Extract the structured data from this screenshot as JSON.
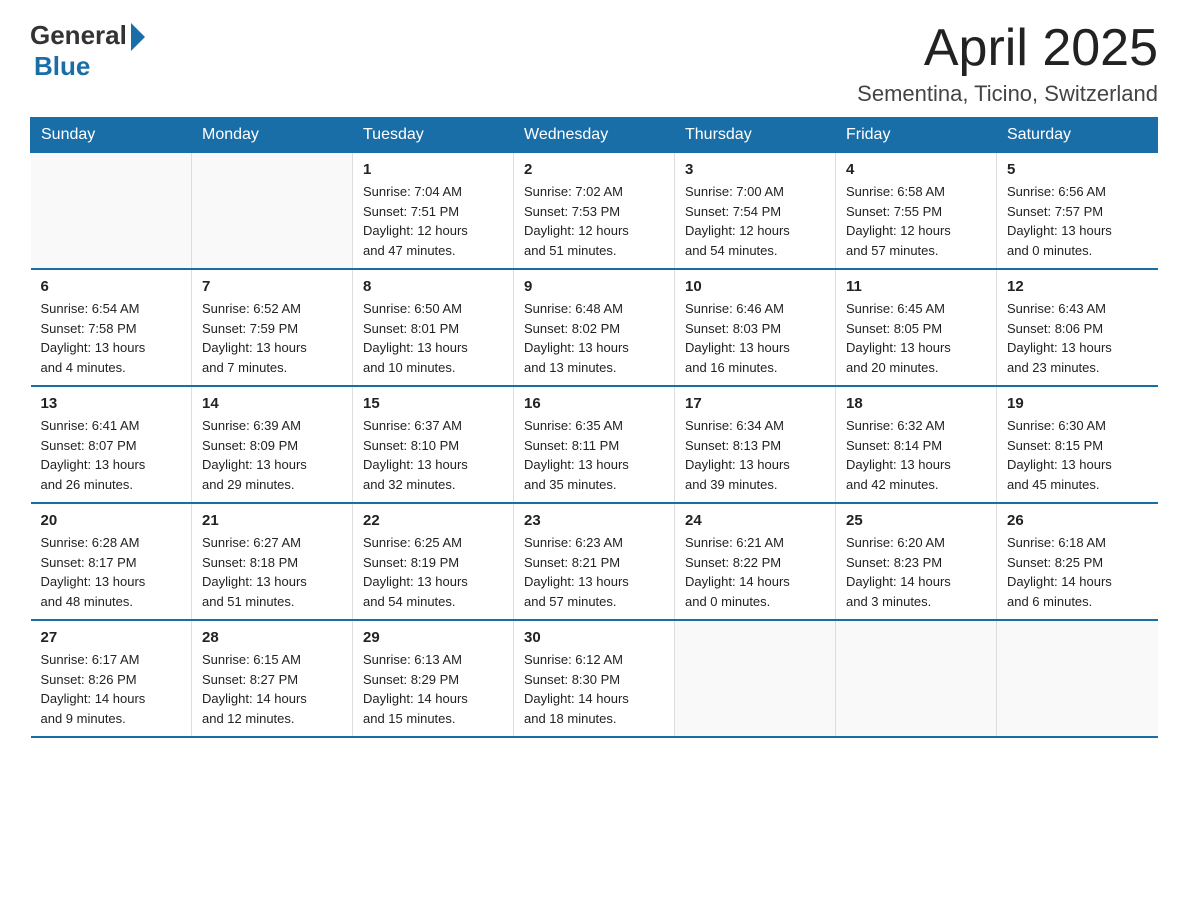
{
  "logo": {
    "general": "General",
    "blue": "Blue"
  },
  "title": "April 2025",
  "subtitle": "Sementina, Ticino, Switzerland",
  "headers": [
    "Sunday",
    "Monday",
    "Tuesday",
    "Wednesday",
    "Thursday",
    "Friday",
    "Saturday"
  ],
  "weeks": [
    [
      {
        "day": "",
        "info": ""
      },
      {
        "day": "",
        "info": ""
      },
      {
        "day": "1",
        "info": "Sunrise: 7:04 AM\nSunset: 7:51 PM\nDaylight: 12 hours\nand 47 minutes."
      },
      {
        "day": "2",
        "info": "Sunrise: 7:02 AM\nSunset: 7:53 PM\nDaylight: 12 hours\nand 51 minutes."
      },
      {
        "day": "3",
        "info": "Sunrise: 7:00 AM\nSunset: 7:54 PM\nDaylight: 12 hours\nand 54 minutes."
      },
      {
        "day": "4",
        "info": "Sunrise: 6:58 AM\nSunset: 7:55 PM\nDaylight: 12 hours\nand 57 minutes."
      },
      {
        "day": "5",
        "info": "Sunrise: 6:56 AM\nSunset: 7:57 PM\nDaylight: 13 hours\nand 0 minutes."
      }
    ],
    [
      {
        "day": "6",
        "info": "Sunrise: 6:54 AM\nSunset: 7:58 PM\nDaylight: 13 hours\nand 4 minutes."
      },
      {
        "day": "7",
        "info": "Sunrise: 6:52 AM\nSunset: 7:59 PM\nDaylight: 13 hours\nand 7 minutes."
      },
      {
        "day": "8",
        "info": "Sunrise: 6:50 AM\nSunset: 8:01 PM\nDaylight: 13 hours\nand 10 minutes."
      },
      {
        "day": "9",
        "info": "Sunrise: 6:48 AM\nSunset: 8:02 PM\nDaylight: 13 hours\nand 13 minutes."
      },
      {
        "day": "10",
        "info": "Sunrise: 6:46 AM\nSunset: 8:03 PM\nDaylight: 13 hours\nand 16 minutes."
      },
      {
        "day": "11",
        "info": "Sunrise: 6:45 AM\nSunset: 8:05 PM\nDaylight: 13 hours\nand 20 minutes."
      },
      {
        "day": "12",
        "info": "Sunrise: 6:43 AM\nSunset: 8:06 PM\nDaylight: 13 hours\nand 23 minutes."
      }
    ],
    [
      {
        "day": "13",
        "info": "Sunrise: 6:41 AM\nSunset: 8:07 PM\nDaylight: 13 hours\nand 26 minutes."
      },
      {
        "day": "14",
        "info": "Sunrise: 6:39 AM\nSunset: 8:09 PM\nDaylight: 13 hours\nand 29 minutes."
      },
      {
        "day": "15",
        "info": "Sunrise: 6:37 AM\nSunset: 8:10 PM\nDaylight: 13 hours\nand 32 minutes."
      },
      {
        "day": "16",
        "info": "Sunrise: 6:35 AM\nSunset: 8:11 PM\nDaylight: 13 hours\nand 35 minutes."
      },
      {
        "day": "17",
        "info": "Sunrise: 6:34 AM\nSunset: 8:13 PM\nDaylight: 13 hours\nand 39 minutes."
      },
      {
        "day": "18",
        "info": "Sunrise: 6:32 AM\nSunset: 8:14 PM\nDaylight: 13 hours\nand 42 minutes."
      },
      {
        "day": "19",
        "info": "Sunrise: 6:30 AM\nSunset: 8:15 PM\nDaylight: 13 hours\nand 45 minutes."
      }
    ],
    [
      {
        "day": "20",
        "info": "Sunrise: 6:28 AM\nSunset: 8:17 PM\nDaylight: 13 hours\nand 48 minutes."
      },
      {
        "day": "21",
        "info": "Sunrise: 6:27 AM\nSunset: 8:18 PM\nDaylight: 13 hours\nand 51 minutes."
      },
      {
        "day": "22",
        "info": "Sunrise: 6:25 AM\nSunset: 8:19 PM\nDaylight: 13 hours\nand 54 minutes."
      },
      {
        "day": "23",
        "info": "Sunrise: 6:23 AM\nSunset: 8:21 PM\nDaylight: 13 hours\nand 57 minutes."
      },
      {
        "day": "24",
        "info": "Sunrise: 6:21 AM\nSunset: 8:22 PM\nDaylight: 14 hours\nand 0 minutes."
      },
      {
        "day": "25",
        "info": "Sunrise: 6:20 AM\nSunset: 8:23 PM\nDaylight: 14 hours\nand 3 minutes."
      },
      {
        "day": "26",
        "info": "Sunrise: 6:18 AM\nSunset: 8:25 PM\nDaylight: 14 hours\nand 6 minutes."
      }
    ],
    [
      {
        "day": "27",
        "info": "Sunrise: 6:17 AM\nSunset: 8:26 PM\nDaylight: 14 hours\nand 9 minutes."
      },
      {
        "day": "28",
        "info": "Sunrise: 6:15 AM\nSunset: 8:27 PM\nDaylight: 14 hours\nand 12 minutes."
      },
      {
        "day": "29",
        "info": "Sunrise: 6:13 AM\nSunset: 8:29 PM\nDaylight: 14 hours\nand 15 minutes."
      },
      {
        "day": "30",
        "info": "Sunrise: 6:12 AM\nSunset: 8:30 PM\nDaylight: 14 hours\nand 18 minutes."
      },
      {
        "day": "",
        "info": ""
      },
      {
        "day": "",
        "info": ""
      },
      {
        "day": "",
        "info": ""
      }
    ]
  ]
}
